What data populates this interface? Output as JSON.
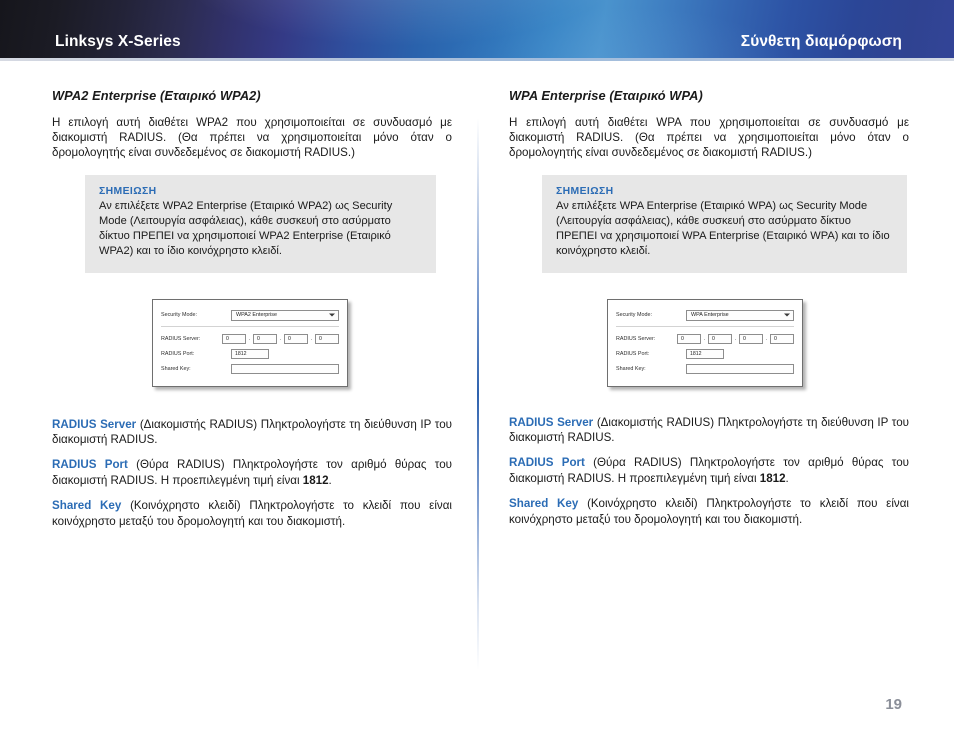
{
  "header": {
    "brand": "Linksys X-Series",
    "section_title": "Σύνθετη διαμόρφωση",
    "accent_color": "#2b6cb5"
  },
  "page_number": "19",
  "columns": [
    {
      "heading": "WPA2 Enterprise (Εταιρικό WPA2)",
      "intro": "Η επιλογή αυτή διαθέτει WPA2 που χρησιμοποιείται σε συνδυασμό με διακομιστή RADIUS. (Θα πρέπει να χρησιμοποιείται μόνο όταν ο δρομολογητής είναι συνδεδεμένος σε διακομιστή RADIUS.)",
      "note": {
        "title": "ΣΗΜΕΙΩΣΗ",
        "body": "Αν επιλέξετε WPA2 Enterprise (Εταιρικό WPA2) ως Security Mode (Λειτουργία ασφάλειας), κάθε συσκευή στο ασύρματο δίκτυο ΠΡΕΠΕΙ να χρησιμοποιεί WPA2 Enterprise (Εταιρικό WPA2) και το ίδιο κοινόχρηστο κλειδί."
      },
      "form": {
        "security_mode_label": "Security Mode:",
        "security_mode_value": "WPA2 Enterprise",
        "radius_server_label": "RADIUS Server:",
        "radius_server_octets": [
          "0",
          "0",
          "0",
          "0"
        ],
        "radius_port_label": "RADIUS Port:",
        "radius_port_value": "1812",
        "shared_key_label": "Shared Key:",
        "shared_key_value": ""
      },
      "definitions": [
        {
          "term": "RADIUS Server",
          "text": " (Διακομιστής RADIUS)  Πληκτρολογήστε τη διεύθυνση IP του διακομιστή RADIUS."
        },
        {
          "term": "RADIUS Port",
          "text_before": " (Θύρα RADIUS) Πληκτρολογήστε τον αριθμό θύρας του διακομιστή RADIUS. Η προεπιλεγμένη τιμή είναι ",
          "bold_value": "1812",
          "text_after": "."
        },
        {
          "term": "Shared Key",
          "text": " (Κοινόχρηστο κλειδί) Πληκτρολογήστε το κλειδί που είναι κοινόχρηστο μεταξύ του δρομολογητή και του διακομιστή."
        }
      ]
    },
    {
      "heading": "WPA Enterprise (Εταιρικό WPA)",
      "intro": "Η επιλογή αυτή διαθέτει WPA που χρησιμοποιείται σε συνδυασμό με διακομιστή RADIUS. (Θα πρέπει να χρησιμοποιείται μόνο όταν ο δρομολογητής είναι συνδεδεμένος σε διακομιστή RADIUS.)",
      "note": {
        "title": "ΣΗΜΕΙΩΣΗ",
        "body": "Αν επιλέξετε WPA Enterprise (Εταιρικό WPA) ως Security Mode (Λειτουργία ασφάλειας), κάθε συσκευή στο ασύρματο δίκτυο ΠΡΕΠΕΙ να χρησιμοποιεί WPA Enterprise (Εταιρικό WPA) και το ίδιο κοινόχρηστο κλειδί."
      },
      "form": {
        "security_mode_label": "Security Mode:",
        "security_mode_value": "WPA Enterprise",
        "radius_server_label": "RADIUS Server:",
        "radius_server_octets": [
          "0",
          "0",
          "0",
          "0"
        ],
        "radius_port_label": "RADIUS Port:",
        "radius_port_value": "1812",
        "shared_key_label": "Shared Key:",
        "shared_key_value": ""
      },
      "definitions": [
        {
          "term": "RADIUS Server",
          "text": " (Διακομιστής RADIUS)  Πληκτρολογήστε τη διεύθυνση IP του διακομιστή RADIUS."
        },
        {
          "term": "RADIUS Port",
          "text_before": " (Θύρα RADIUS) Πληκτρολογήστε τον αριθμό θύρας του διακομιστή RADIUS. Η προεπιλεγμένη τιμή είναι ",
          "bold_value": "1812",
          "text_after": "."
        },
        {
          "term": "Shared Key",
          "text": " (Κοινόχρηστο κλειδί) Πληκτρολογήστε το κλειδί που είναι κοινόχρηστο μεταξύ του δρομολογητή και του διακομιστή."
        }
      ]
    }
  ]
}
